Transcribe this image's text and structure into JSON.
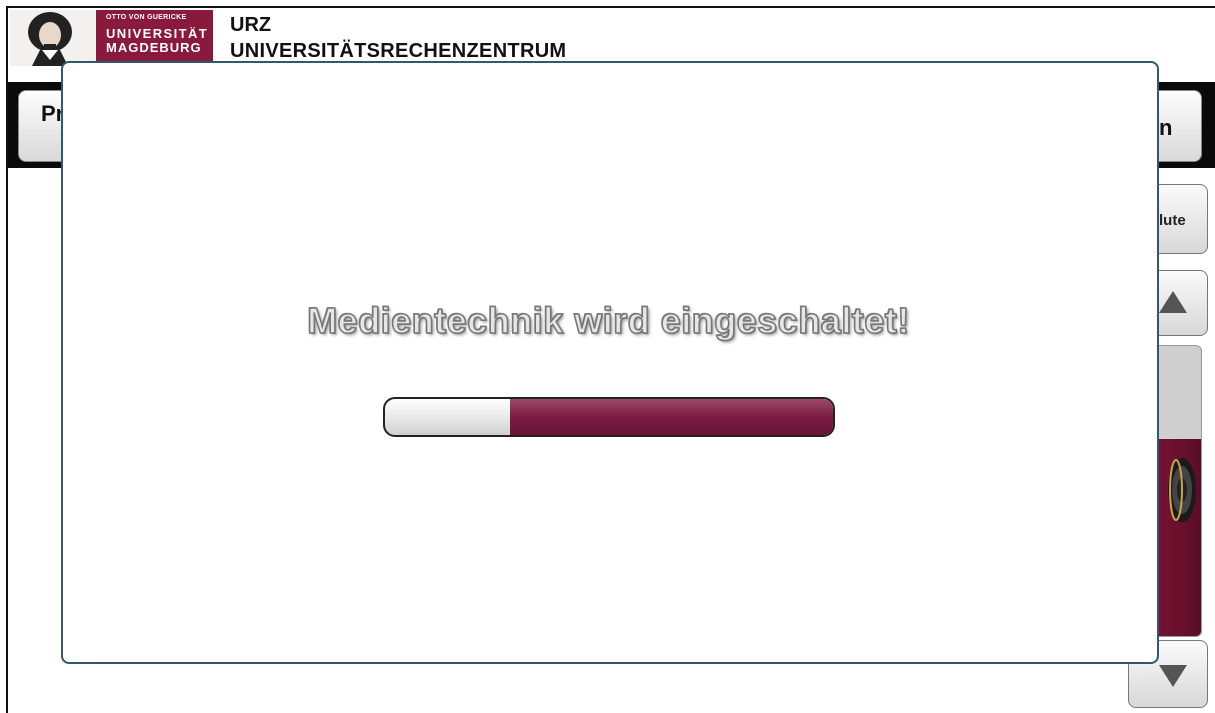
{
  "header": {
    "logo": {
      "line1": "OTTO VON GUERICKE",
      "line2": "UNIVERSITÄT",
      "line3": "MAGDEBURG"
    },
    "org_short": "URZ",
    "org_long": "UNIVERSITÄTSRECHENZENTRUM",
    "brand_color": "#8a1a3c"
  },
  "nav": {
    "left_button_label": "Pr",
    "right_button_label": "n"
  },
  "side_controls": {
    "mute_label": "lute",
    "volume_level": 0.68
  },
  "modal": {
    "message": "Medientechnik wird eingeschaltet!",
    "progress": 0.72,
    "progress_color": "#7c1c44",
    "border_color": "#2e5a6b"
  }
}
